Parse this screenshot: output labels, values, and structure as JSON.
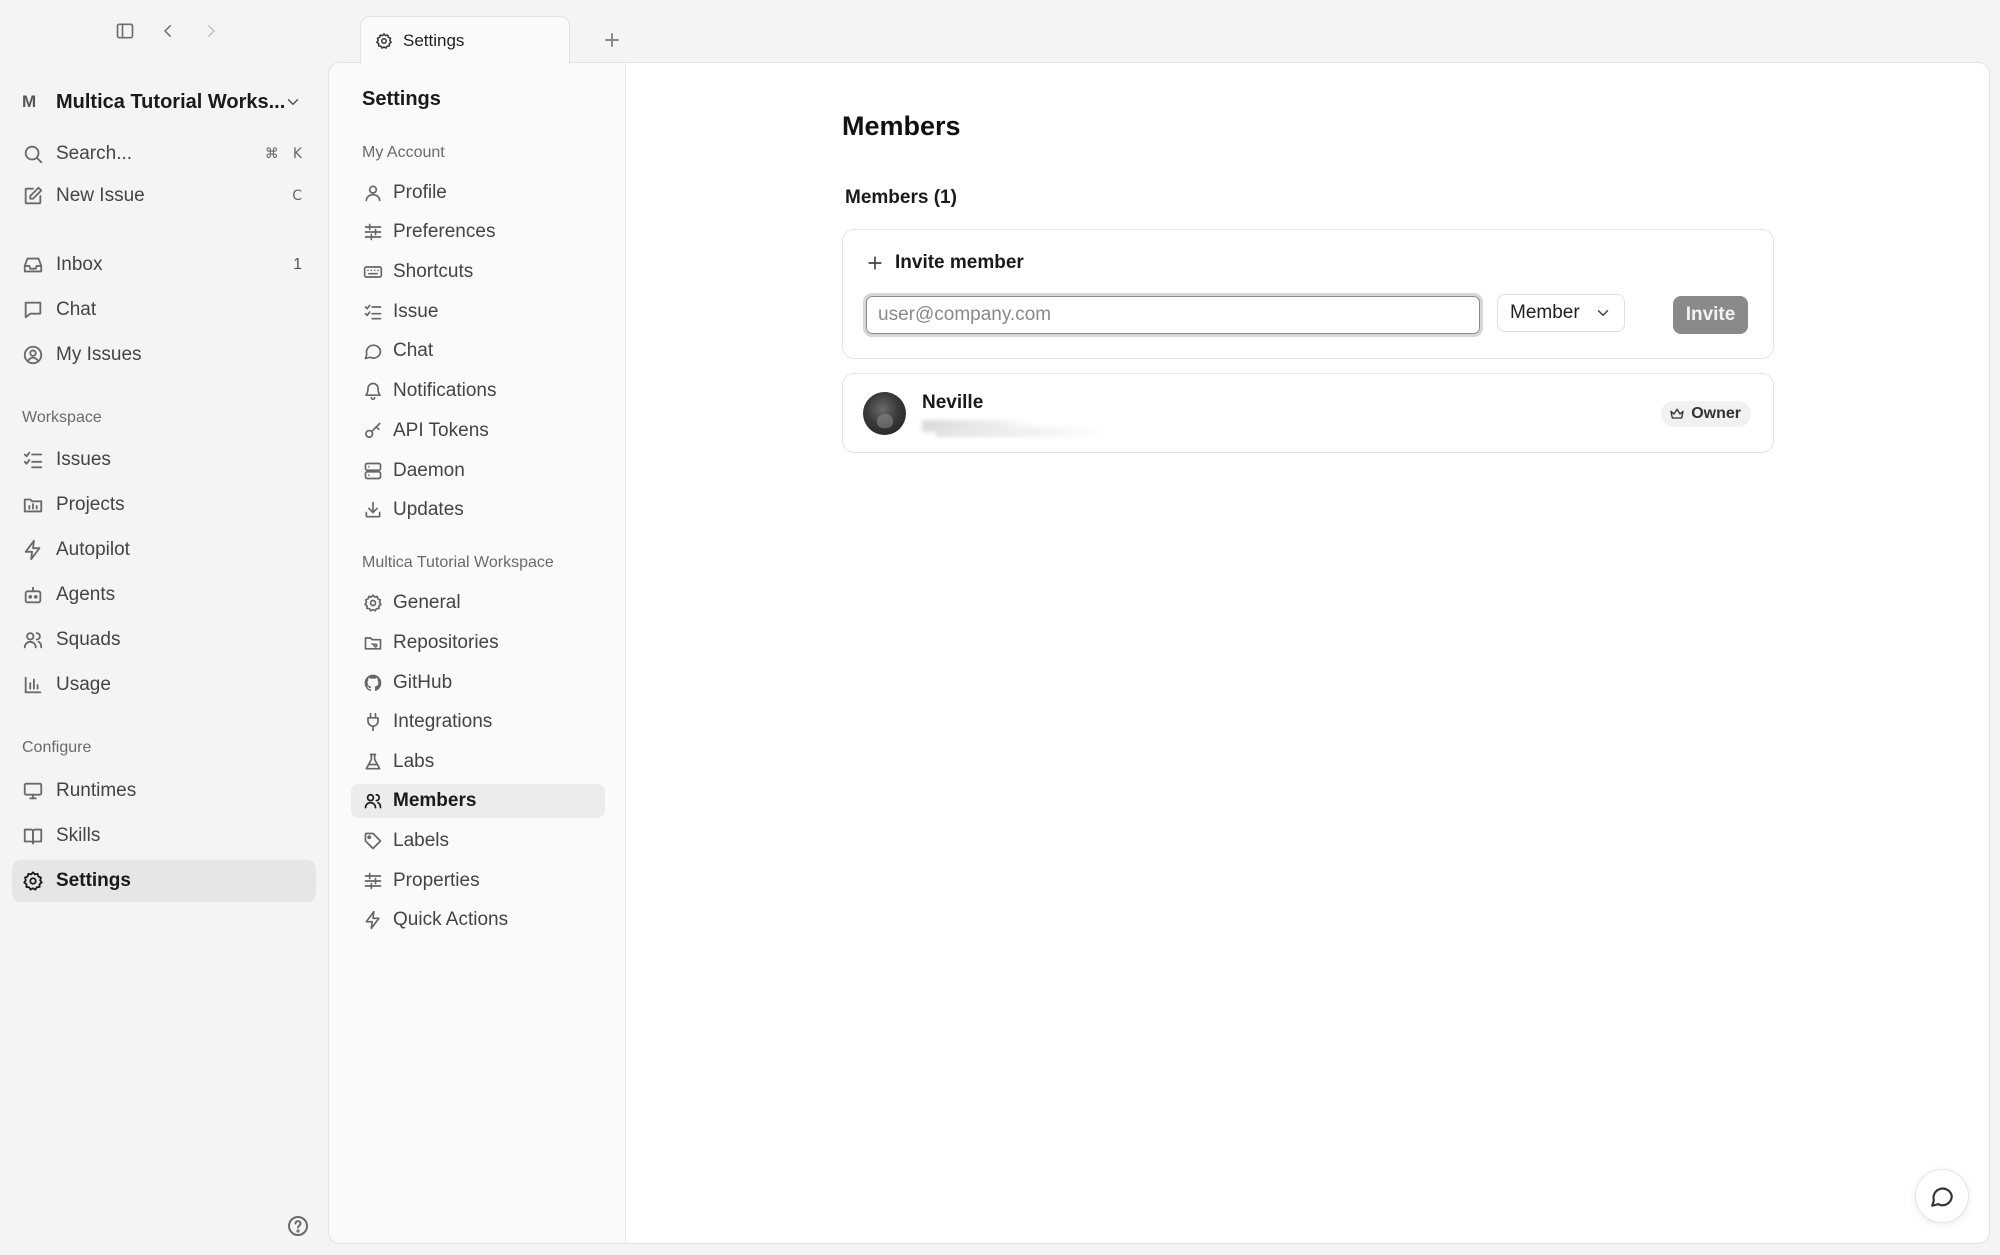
{
  "window": {
    "tab_title": "Settings"
  },
  "workspace": {
    "avatar_letter": "M",
    "name": "Multica Tutorial Works..."
  },
  "sidebar": {
    "search": {
      "label": "Search...",
      "shortcut_cmd": "⌘",
      "shortcut_key": "K"
    },
    "new_issue": {
      "label": "New Issue",
      "shortcut": "C"
    },
    "inbox": {
      "label": "Inbox",
      "count": "1"
    },
    "chat": {
      "label": "Chat"
    },
    "my_issues": {
      "label": "My Issues"
    },
    "workspace_label": "Workspace",
    "workspace_items": [
      {
        "label": "Issues",
        "icon": "issues-icon"
      },
      {
        "label": "Projects",
        "icon": "projects-icon"
      },
      {
        "label": "Autopilot",
        "icon": "lightning-icon"
      },
      {
        "label": "Agents",
        "icon": "bot-icon"
      },
      {
        "label": "Squads",
        "icon": "users-icon"
      },
      {
        "label": "Usage",
        "icon": "bar-chart-icon"
      }
    ],
    "configure_label": "Configure",
    "configure_items": [
      {
        "label": "Runtimes",
        "icon": "monitor-icon"
      },
      {
        "label": "Skills",
        "icon": "book-icon"
      },
      {
        "label": "Settings",
        "icon": "gear-icon",
        "active": true
      }
    ]
  },
  "settings_nav": {
    "title": "Settings",
    "account_label": "My Account",
    "account_items": [
      {
        "label": "Profile",
        "icon": "user-icon"
      },
      {
        "label": "Preferences",
        "icon": "sliders-icon"
      },
      {
        "label": "Shortcuts",
        "icon": "keyboard-icon"
      },
      {
        "label": "Issue",
        "icon": "issues-icon"
      },
      {
        "label": "Chat",
        "icon": "chat-bubble-icon"
      },
      {
        "label": "Notifications",
        "icon": "bell-icon"
      },
      {
        "label": "API Tokens",
        "icon": "key-icon"
      },
      {
        "label": "Daemon",
        "icon": "server-icon"
      },
      {
        "label": "Updates",
        "icon": "download-icon"
      }
    ],
    "workspace_label": "Multica Tutorial Workspace",
    "workspace_items": [
      {
        "label": "General",
        "icon": "gear-icon"
      },
      {
        "label": "Repositories",
        "icon": "folder-git-icon"
      },
      {
        "label": "GitHub",
        "icon": "github-icon"
      },
      {
        "label": "Integrations",
        "icon": "plug-icon"
      },
      {
        "label": "Labs",
        "icon": "flask-icon"
      },
      {
        "label": "Members",
        "icon": "users-icon",
        "active": true
      },
      {
        "label": "Labels",
        "icon": "tag-icon"
      },
      {
        "label": "Properties",
        "icon": "sliders-icon"
      },
      {
        "label": "Quick Actions",
        "icon": "lightning-icon"
      }
    ]
  },
  "main": {
    "title": "Members",
    "members_count": "Members (1)",
    "invite": {
      "heading": "Invite member",
      "email_placeholder": "user@company.com",
      "email_value": "",
      "role_value": "Member",
      "button": "Invite"
    },
    "members": [
      {
        "name": "Neville",
        "role": "Owner"
      }
    ]
  },
  "colors": {
    "active_bg": "#e6e6e6",
    "invite_button_bg": "#8a8a8a",
    "page_bg": "#f4f4f4"
  }
}
